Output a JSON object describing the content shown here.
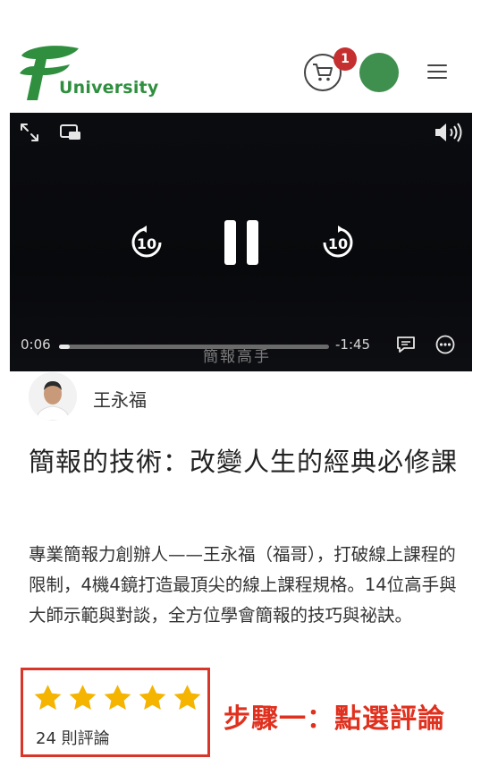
{
  "header": {
    "brand_text": "University",
    "cart_count": "1"
  },
  "video": {
    "current_time": "0:06",
    "remaining_time": "-1:45",
    "progress_fraction": 0.04,
    "subtitle_text": "簡報高手",
    "rewind_seconds": "10",
    "forward_seconds": "10"
  },
  "instructor": {
    "name": "王永福"
  },
  "course": {
    "title": "簡報的技術：改變人生的經典必修課",
    "description": "專業簡報力創辦人——王永福（福哥），打破線上課程的限制，4機4鏡打造最頂尖的線上課程規格。14位高手與大師示範與對談，全方位學會簡報的技巧與祕訣。"
  },
  "rating": {
    "stars": 5,
    "review_count_text": "24 則評論"
  },
  "annotation": {
    "text": "步驟一：點選評論"
  },
  "colors": {
    "brand_green": "#2f8f3f",
    "star_color": "#f5b400",
    "badge_red": "#c62f2f",
    "highlight_red": "#d9362a"
  }
}
